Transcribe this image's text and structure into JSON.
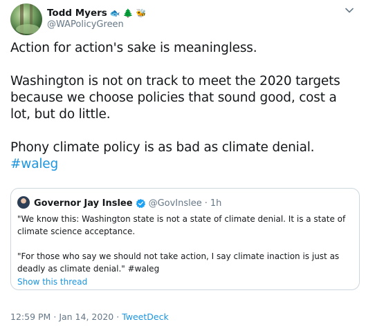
{
  "author": {
    "display_name": "Todd Myers",
    "emojis": [
      "🐟",
      "🌲",
      "🐝"
    ],
    "handle": "@WAPolicyGreen"
  },
  "tweet": {
    "paragraphs": [
      "Action for action's sake is meaningless.",
      "Washington is not on track to meet the 2020 targets because we choose policies that sound good, cost a lot, but do little.",
      "Phony climate policy is as bad as climate denial."
    ],
    "hashtag": "#waleg"
  },
  "quoted_tweet": {
    "display_name": "Governor Jay Inslee",
    "handle": "@GovInslee",
    "separator": "·",
    "time_ago": "1h",
    "paragraph_1": "\"We know this: Washington state is not a state of climate denial. It is a state of climate science acceptance.",
    "paragraph_2": "\"For those who say we should not take action, I say climate inaction is just as deadly as climate denial.\" #waleg",
    "show_thread_label": "Show this thread"
  },
  "meta": {
    "time": "12:59 PM",
    "separator_1": "·",
    "date": "Jan 14, 2020",
    "separator_2": "·",
    "source": "TweetDeck"
  },
  "colors": {
    "link_blue": "#1b95e0",
    "secondary_gray": "#657786",
    "border_gray": "#ccd6dd",
    "text": "#14171a"
  },
  "icons": {
    "verified": "verified-badge-icon",
    "menu": "chevron-down-icon"
  }
}
